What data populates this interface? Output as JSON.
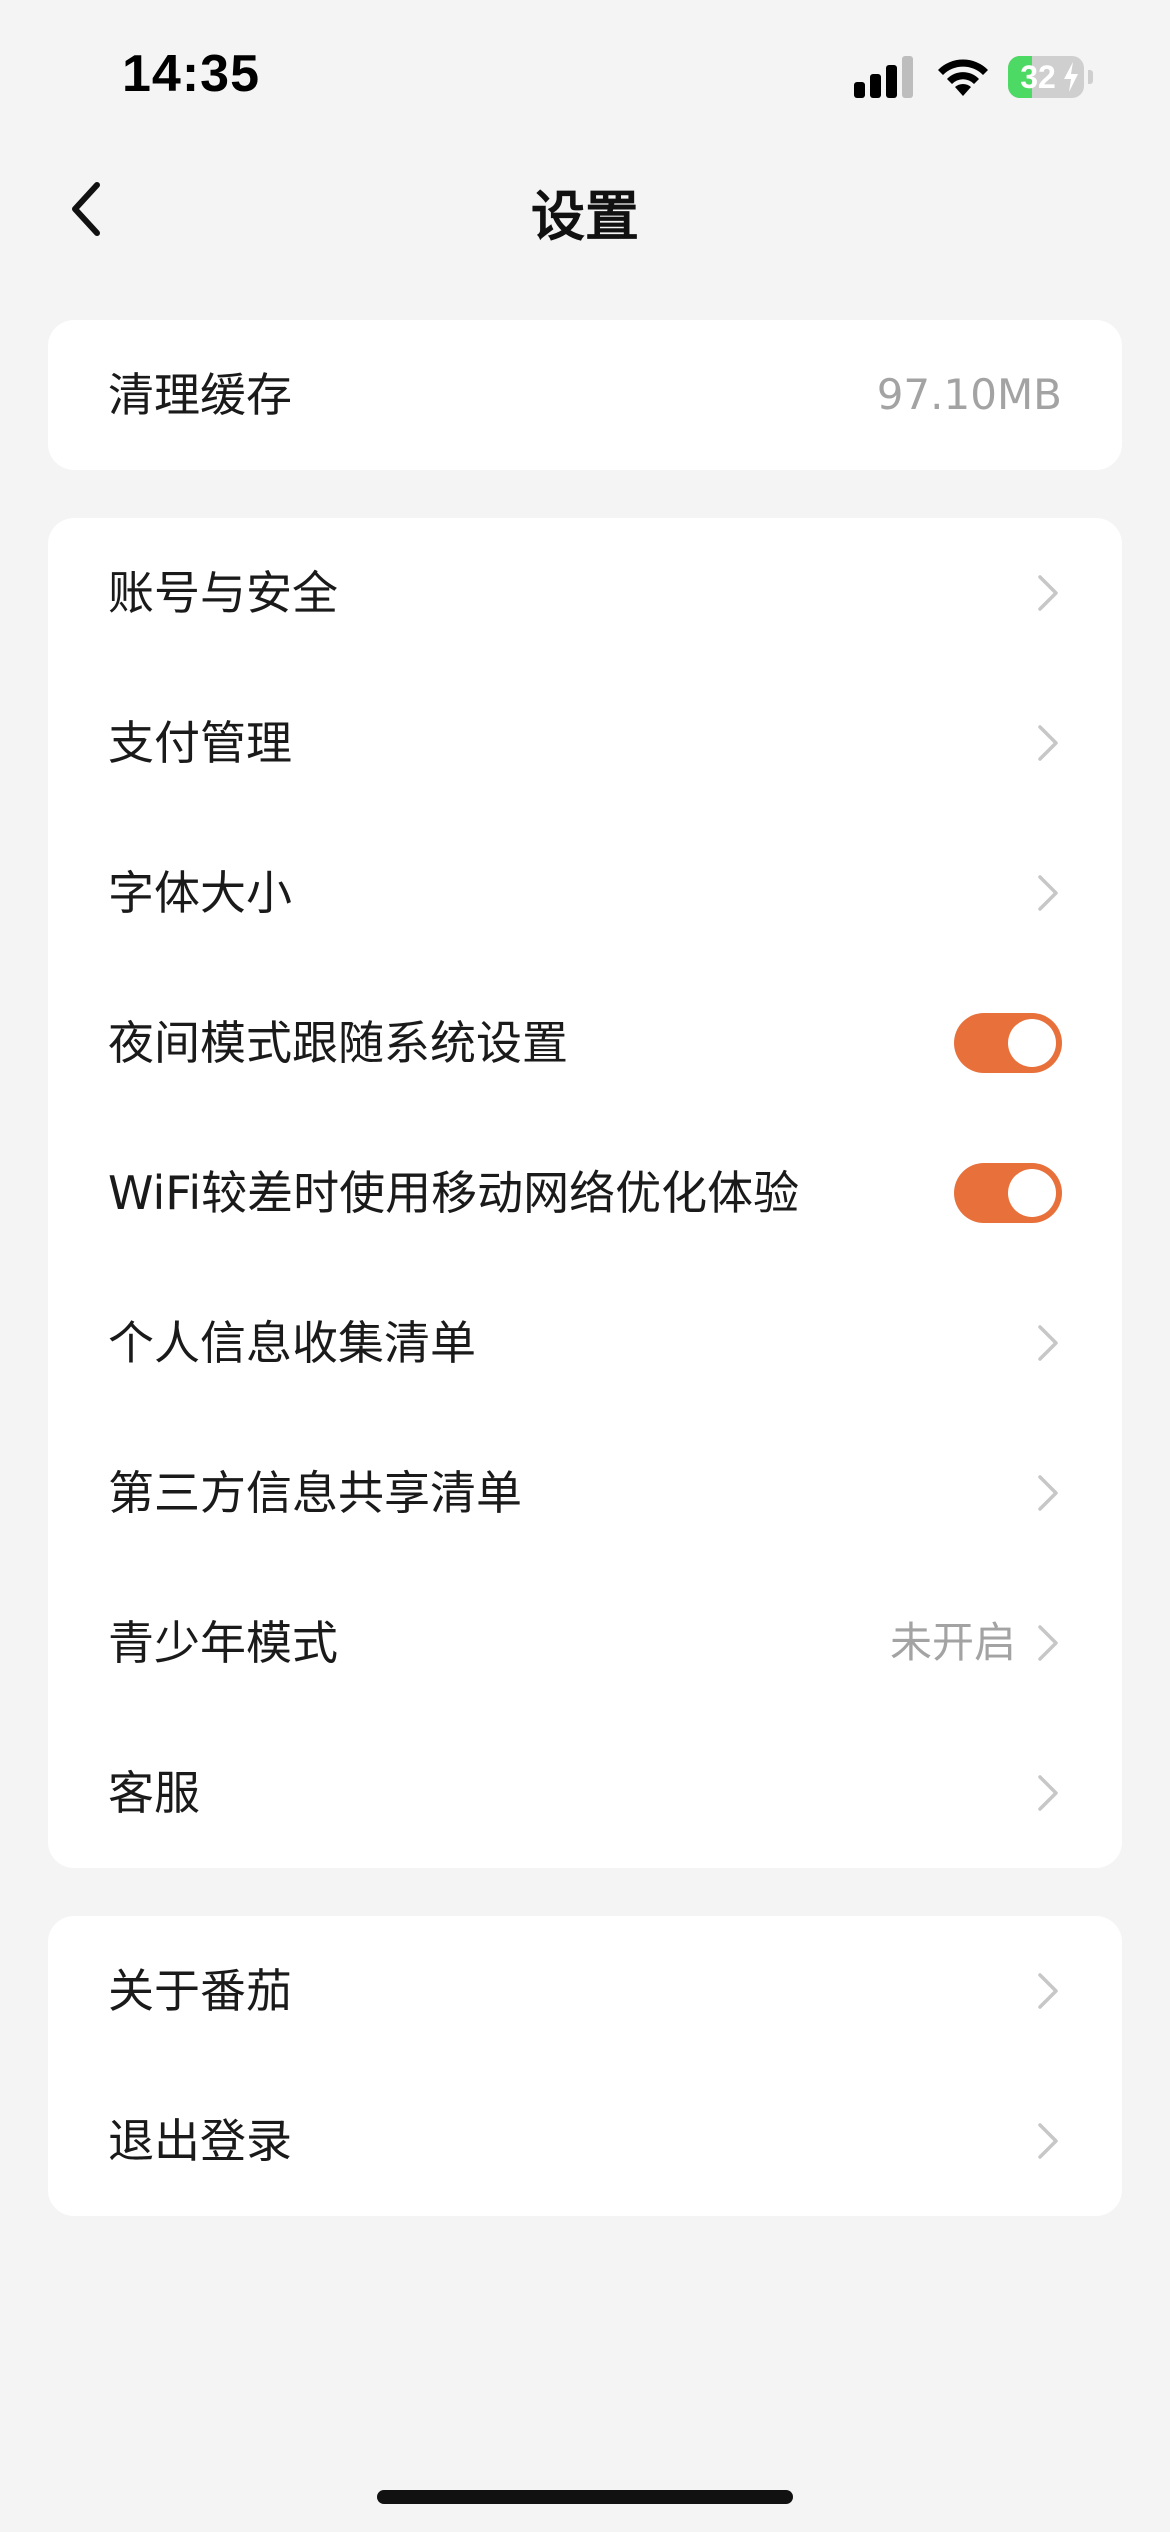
{
  "status_bar": {
    "time": "14:35",
    "battery_level": "32",
    "battery_fraction": 0.32
  },
  "nav": {
    "title": "设置"
  },
  "cache_card": {
    "label": "清理缓存",
    "value": "97.10MB"
  },
  "settings_card": {
    "items": [
      {
        "label": "账号与安全"
      },
      {
        "label": "支付管理"
      },
      {
        "label": "字体大小"
      },
      {
        "label": "夜间模式跟随系统设置",
        "toggle_on": true
      },
      {
        "label": "WiFi较差时使用移动网络优化体验",
        "toggle_on": true
      },
      {
        "label": "个人信息收集清单"
      },
      {
        "label": "第三方信息共享清单"
      },
      {
        "label": "青少年模式",
        "value": "未开启"
      },
      {
        "label": "客服"
      }
    ]
  },
  "account_card": {
    "items": [
      {
        "label": "关于番茄"
      },
      {
        "label": "退出登录"
      }
    ]
  },
  "colors": {
    "accent": "#e8703a",
    "background": "#f4f4f4",
    "card": "#ffffff",
    "secondary_text": "#a3a3a3",
    "chevron": "#c7c7c7"
  }
}
